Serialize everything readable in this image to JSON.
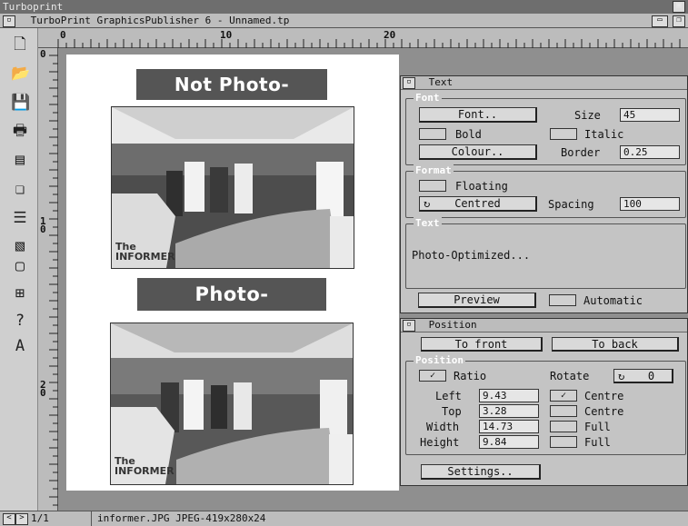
{
  "screen": {
    "title": "Turboprint"
  },
  "window": {
    "title": "TurboPrint GraphicsPublisher 6 - Unnamed.tp"
  },
  "ruler": {
    "h_marks": [
      "0",
      "10",
      "20"
    ],
    "v_marks": [
      "0",
      "1\n0",
      "2\n0"
    ]
  },
  "toolbar": {
    "icons": [
      "new-page-icon",
      "open-icon",
      "save-icon",
      "print-icon",
      "page-setup-icon",
      "copy-page-icon",
      "layers-icon",
      "graphics-icon",
      "text-frame-icon",
      "grid-icon",
      "help-icon",
      "text-tool-icon"
    ]
  },
  "page": {
    "label_top": "Not Photo-Optimized...",
    "label_bottom": "Photo-Optimized...",
    "photo_sign_text": "The\nINFORMER"
  },
  "text_panel": {
    "title": "Text",
    "font_group": "Font",
    "font_button": "Font..",
    "size_label": "Size",
    "size_value": "45",
    "bold_label": "Bold",
    "italic_label": "Italic",
    "colour_button": "Colour..",
    "border_label": "Border",
    "border_value": "0.25",
    "format_group": "Format",
    "floating_label": "Floating",
    "align_value": "Centred",
    "spacing_label": "Spacing",
    "spacing_value": "100",
    "text_group": "Text",
    "text_content": "Photo-Optimized...",
    "preview_button": "Preview",
    "automatic_label": "Automatic"
  },
  "position_panel": {
    "title": "Position",
    "to_front_button": "To front",
    "to_back_button": "To back",
    "group_title": "Position",
    "ratio_label": "Ratio",
    "rotate_label": "Rotate",
    "rotate_value": "0",
    "left_label": "Left",
    "left_value": "9.43",
    "top_label": "Top",
    "top_value": "3.28",
    "width_label": "Width",
    "width_value": "14.73",
    "height_label": "Height",
    "height_value": "9.84",
    "centre1_label": "Centre",
    "centre2_label": "Centre",
    "full1_label": "Full",
    "full2_label": "Full",
    "settings_button": "Settings.."
  },
  "status": {
    "page_indicator": "1/1",
    "file_info": "informer.JPG JPEG-419x280x24"
  },
  "colors": {
    "label_bg": "#555555",
    "panel_bg": "#c4c4c4",
    "workspace": "#8f8f8f"
  }
}
